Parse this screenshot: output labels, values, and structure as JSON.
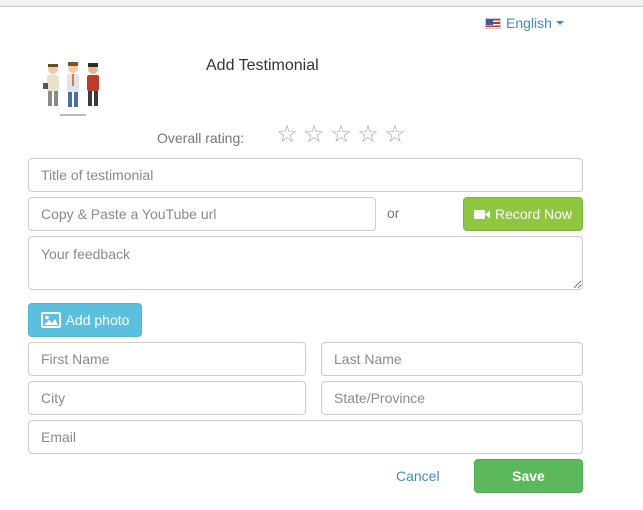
{
  "language": {
    "label": "English",
    "icon": "us-flag-icon"
  },
  "header": {
    "title": "Add Testimonial",
    "logo": "people-illustration"
  },
  "rating": {
    "label": "Overall rating:",
    "stars": [
      "☆",
      "☆",
      "☆",
      "☆",
      "☆"
    ]
  },
  "form": {
    "title_placeholder": "Title of testimonial",
    "youtube_placeholder": "Copy & Paste a YouTube url",
    "or_text": "or",
    "record_label": "Record Now",
    "feedback_placeholder": "Your feedback",
    "add_photo_label": "Add photo",
    "first_name_placeholder": "First Name",
    "last_name_placeholder": "Last Name",
    "city_placeholder": "City",
    "state_placeholder": "State/Province",
    "email_placeholder": "Email"
  },
  "actions": {
    "cancel_label": "Cancel",
    "save_label": "Save"
  },
  "colors": {
    "record": "#8ec63f",
    "photo": "#5bc0de",
    "save": "#5cb85c",
    "link": "#428bca"
  }
}
